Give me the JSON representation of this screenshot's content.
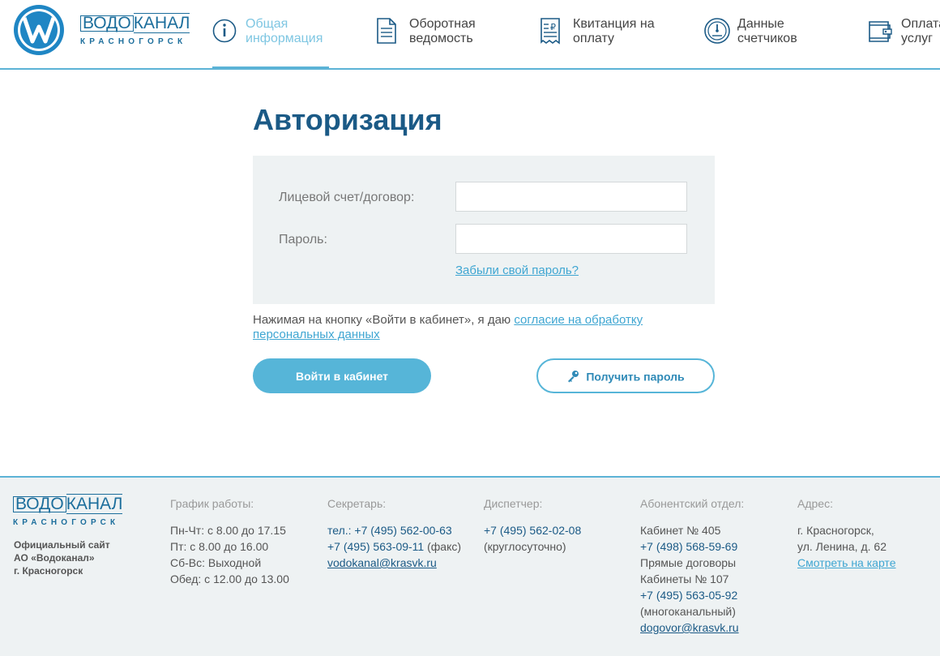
{
  "header": {
    "logo_word": "ВОДОКАНАЛ",
    "logo_word_a": "ВОДО",
    "logo_word_b": "КАНАЛ",
    "logo_city": "КРАСНОГОРСК",
    "nav": [
      {
        "line1": "Общая",
        "line2": "информация",
        "icon": "info-icon",
        "active": true
      },
      {
        "line1": "Оборотная",
        "line2": "ведомость",
        "icon": "document-icon",
        "active": false
      },
      {
        "line1": "Квитанция на",
        "line2": "оплату",
        "icon": "receipt-icon",
        "active": false
      },
      {
        "line1": "Данные",
        "line2": "счетчиков",
        "icon": "meter-icon",
        "active": false
      },
      {
        "line1": "Оплата",
        "line2": "услуг",
        "icon": "wallet-icon",
        "active": false
      }
    ],
    "accent_color": "#5cb3d6",
    "brand_color": "#1c6e9c"
  },
  "main": {
    "title": "Авторизация",
    "account_label": "Лицевой счет/договор:",
    "account_value": "",
    "password_label": "Пароль:",
    "password_value": "",
    "forgot_link": "Забыли свой пароль?",
    "consent_text": "Нажимая на кнопку «Войти в кабинет», я даю ",
    "consent_link": "согласие на обработку персональных данных",
    "login_button": "Войти в кабинет",
    "get_password_button": "Получить пароль",
    "get_password_icon": "key-icon"
  },
  "footer": {
    "logo_word_a": "ВОДО",
    "logo_word_b": "КАНАЛ",
    "logo_city": "КРАСНОГОРСК",
    "desc_lines": [
      "Официальный сайт",
      "АО «Водоканал»",
      "г. Красногорск"
    ],
    "schedule": {
      "head": "График работы:",
      "lines": [
        "Пн-Чт: с 8.00 до 17.15",
        "Пт: с 8.00 до 16.00",
        "Сб-Вс: Выходной",
        "Обед: с 12.00 до 13.00"
      ]
    },
    "secretary": {
      "head": "Секретарь:",
      "phone1": "тел.: +7 (495) 562-00-63",
      "phone2": "+7 (495) 563-09-11",
      "phone2_note": " (факс)",
      "email": "vodokanal@krasvk.ru"
    },
    "dispatcher": {
      "head": "Диспетчер:",
      "phone": "+7 (495) 562-02-08",
      "note": "(круглосуточно)"
    },
    "subscriber": {
      "head": "Абонентский отдел:",
      "lines": [
        "Кабинет № 405",
        "+7 (498) 568-59-69",
        "Прямые договоры",
        "Кабинеты № 107",
        "+7 (495) 563-05-92",
        "(многоканальный)"
      ],
      "email": "dogovor@krasvk.ru"
    },
    "address": {
      "head": "Адрес:",
      "line1": "г. Красногорск,",
      "line2": "ул. Ленина, д. 62",
      "map_link": "Смотреть на карте"
    }
  }
}
